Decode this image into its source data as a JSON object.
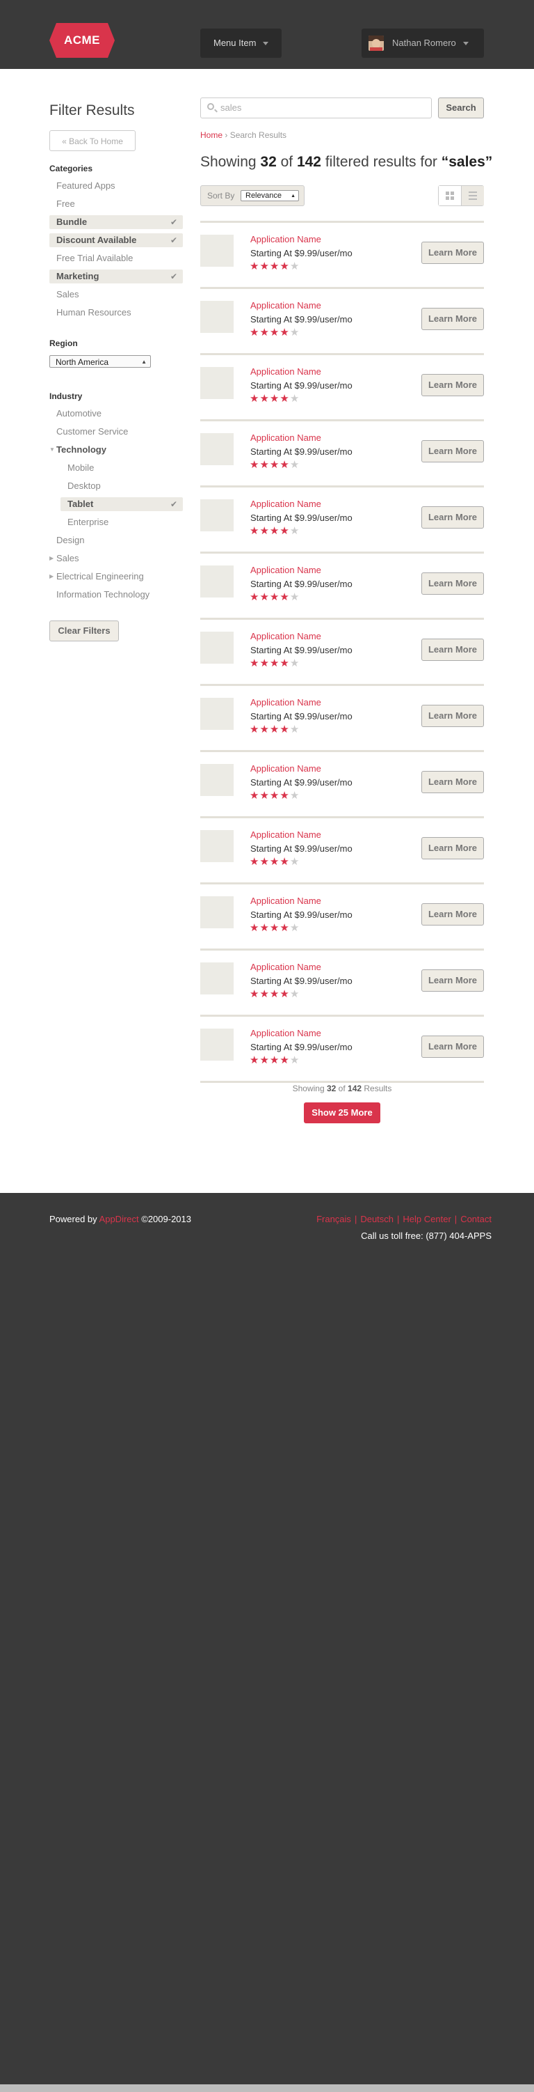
{
  "header": {
    "logo_text": "ACME",
    "menu_label": "Menu Item",
    "user_name": "Nathan Romero"
  },
  "sidebar": {
    "title": "Filter Results",
    "back_label": "« Back To Home",
    "categories_heading": "Categories",
    "categories": [
      {
        "label": "Featured Apps",
        "selected": false
      },
      {
        "label": "Free",
        "selected": false
      },
      {
        "label": "Bundle",
        "selected": true
      },
      {
        "label": "Discount Available",
        "selected": true
      },
      {
        "label": "Free Trial Available",
        "selected": false
      },
      {
        "label": "Marketing",
        "selected": true
      },
      {
        "label": "Sales",
        "selected": false
      },
      {
        "label": "Human Resources",
        "selected": false
      }
    ],
    "region_heading": "Region",
    "region_value": "North America",
    "industry_heading": "Industry",
    "industry": {
      "automotive": "Automotive",
      "customer_service": "Customer Service",
      "technology": "Technology",
      "mobile": "Mobile",
      "desktop": "Desktop",
      "tablet": "Tablet",
      "enterprise": "Enterprise",
      "design": "Design",
      "sales": "Sales",
      "electrical": "Electrical Engineering",
      "it": "Information Technology"
    },
    "clear_label": "Clear Filters"
  },
  "search": {
    "value": "sales",
    "button_label": "Search"
  },
  "breadcrumb": {
    "home": "Home",
    "sep": " › ",
    "current": "Search Results"
  },
  "summary": {
    "prefix": "Showing ",
    "shown": "32",
    "of": " of ",
    "total": "142",
    "middle": " filtered results for ",
    "query": "“sales”"
  },
  "sort": {
    "label": "Sort By",
    "value": "Relevance"
  },
  "results": [
    {
      "name": "Application Name",
      "price": "Starting At $9.99/user/mo",
      "rating": 4,
      "button": "Learn More"
    },
    {
      "name": "Application Name",
      "price": "Starting At $9.99/user/mo",
      "rating": 4,
      "button": "Learn More"
    },
    {
      "name": "Application Name",
      "price": "Starting At $9.99/user/mo",
      "rating": 4,
      "button": "Learn More"
    },
    {
      "name": "Application Name",
      "price": "Starting At $9.99/user/mo",
      "rating": 4,
      "button": "Learn More"
    },
    {
      "name": "Application Name",
      "price": "Starting At $9.99/user/mo",
      "rating": 4,
      "button": "Learn More"
    },
    {
      "name": "Application Name",
      "price": "Starting At $9.99/user/mo",
      "rating": 4,
      "button": "Learn More"
    },
    {
      "name": "Application Name",
      "price": "Starting At $9.99/user/mo",
      "rating": 4,
      "button": "Learn More"
    },
    {
      "name": "Application Name",
      "price": "Starting At $9.99/user/mo",
      "rating": 4,
      "button": "Learn More"
    },
    {
      "name": "Application Name",
      "price": "Starting At $9.99/user/mo",
      "rating": 4,
      "button": "Learn More"
    },
    {
      "name": "Application Name",
      "price": "Starting At $9.99/user/mo",
      "rating": 4,
      "button": "Learn More"
    },
    {
      "name": "Application Name",
      "price": "Starting At $9.99/user/mo",
      "rating": 4,
      "button": "Learn More"
    },
    {
      "name": "Application Name",
      "price": "Starting At $9.99/user/mo",
      "rating": 4,
      "button": "Learn More"
    },
    {
      "name": "Application Name",
      "price": "Starting At $9.99/user/mo",
      "rating": 4,
      "button": "Learn More"
    }
  ],
  "pagination": {
    "prefix": "Showing ",
    "shown": "32",
    "of": " of ",
    "total": "142",
    "suffix": " Results",
    "more_label": "Show 25 More"
  },
  "footer": {
    "powered_prefix": "Powered by ",
    "brand": "AppDirect",
    "copyright": " ©2009-2013",
    "links": [
      "Français",
      "Deutsch",
      "Help Center",
      "Contact"
    ],
    "toll_free": "Call us toll free: (877) 404-APPS"
  },
  "colors": {
    "accent": "#d9344b",
    "dark_bg": "#3a3a3a",
    "selected_filter_bg": "#eceae4"
  },
  "icons": [
    "search-icon",
    "caret-down-icon",
    "check-icon",
    "grid-view-icon",
    "list-view-icon",
    "star-icon",
    "expand-triangle-icon"
  ]
}
